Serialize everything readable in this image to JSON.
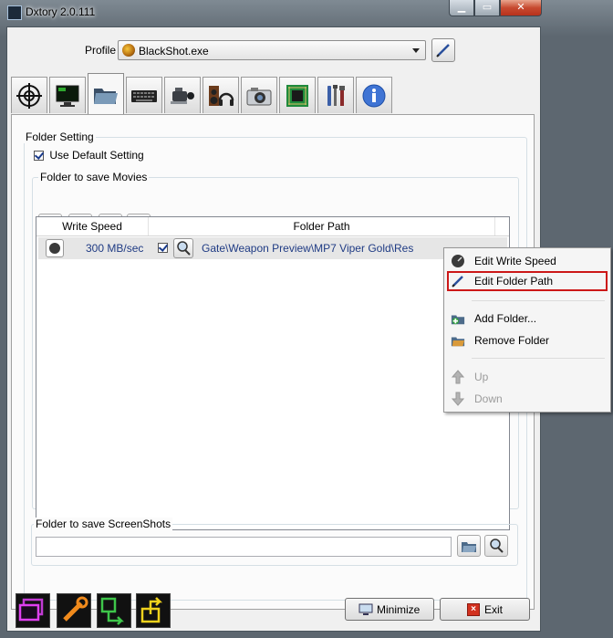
{
  "window": {
    "title": "Dxtory 2.0.111",
    "minimize_glyph": "▁",
    "maximize_glyph": "▭",
    "close_glyph": "✕"
  },
  "profile": {
    "label": "Profile",
    "value": "BlackShot.exe"
  },
  "tabs": [
    {
      "icon": "crosshair-icon"
    },
    {
      "icon": "monitor-icon"
    },
    {
      "icon": "folder-icon",
      "active": true
    },
    {
      "icon": "keyboard-icon"
    },
    {
      "icon": "camcorder-icon"
    },
    {
      "icon": "speaker-headphones-icon"
    },
    {
      "icon": "camera-icon"
    },
    {
      "icon": "chip-icon"
    },
    {
      "icon": "tools-icon"
    },
    {
      "icon": "info-icon"
    }
  ],
  "folder_setting": {
    "title": "Folder Setting",
    "use_default_label": "Use Default Setting",
    "movies": {
      "title": "Folder to save Movies",
      "columns": [
        "Write Speed",
        "Folder Path"
      ],
      "rows": [
        {
          "write_speed": "300 MB/sec",
          "folder_path": "Gate\\Weapon Preview\\MP7 Viper Gold\\Res"
        }
      ]
    },
    "screenshots": {
      "title": "Folder to save ScreenShots",
      "path_value": ""
    }
  },
  "context_menu": {
    "items": [
      {
        "label": "Edit Write Speed",
        "icon": "gauge-icon",
        "enabled": true
      },
      {
        "label": "Edit Folder Path",
        "icon": "pen-icon",
        "enabled": true,
        "highlighted": true
      },
      {
        "label": "Add Folder...",
        "icon": "add-folder-icon",
        "enabled": true
      },
      {
        "label": "Remove Folder",
        "icon": "remove-folder-icon",
        "enabled": true
      },
      {
        "label": "Up",
        "icon": "arrow-up-icon",
        "enabled": false
      },
      {
        "label": "Down",
        "icon": "arrow-down-icon",
        "enabled": false
      }
    ]
  },
  "footer": {
    "minimize_label": "Minimize",
    "exit_label": "Exit"
  },
  "colors": {
    "accent_text": "#1f3b84",
    "highlight_border": "#cc1818"
  }
}
